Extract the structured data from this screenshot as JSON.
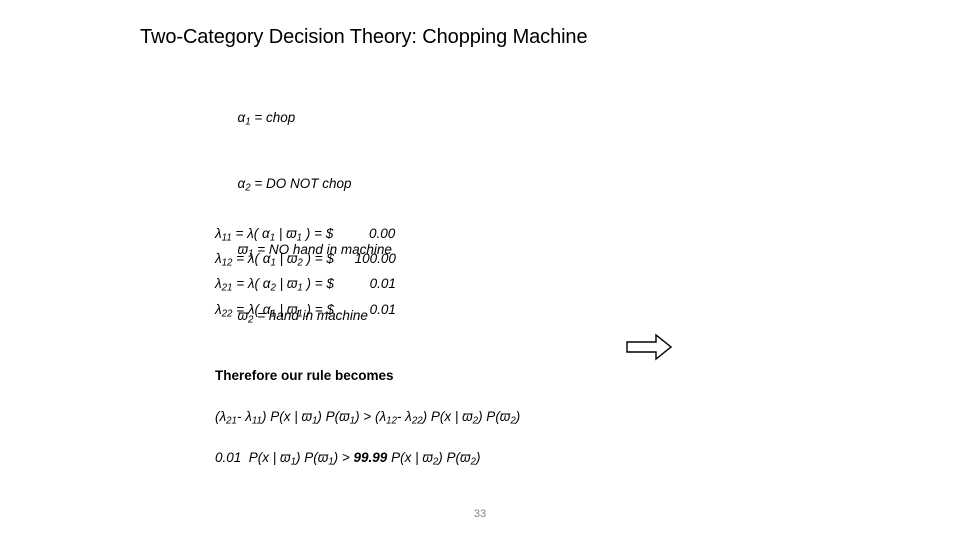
{
  "slide": {
    "title": "Two-Category Decision Theory: Chopping Machine",
    "page_number": "33",
    "page_number_color": "#808080",
    "background_color": "#ffffff",
    "text_color": "#000000"
  },
  "definitions": [
    {
      "symbol": "α",
      "subscript": "1",
      "equals": " = ",
      "meaning": "chop"
    },
    {
      "symbol": "α",
      "subscript": "2",
      "equals": " = ",
      "meaning": "DO NOT chop"
    },
    {
      "symbol": "ϖ",
      "subscript": "1",
      "equals": " = ",
      "meaning": "NO hand in machine"
    },
    {
      "symbol": "ϖ",
      "subscript": "2",
      "equals": " = ",
      "meaning": "hand in machine"
    }
  ],
  "losses": [
    {
      "label_symbol": "λ",
      "label_subscript": "11",
      "expression": " = λ( α",
      "action_subscript": "1",
      "bar": " | ϖ",
      "state_subscript": "1",
      "tail": " ) = $",
      "amount": "0.00"
    },
    {
      "label_symbol": "λ",
      "label_subscript": "12",
      "expression": " = λ( α",
      "action_subscript": "1",
      "bar": " | ϖ",
      "state_subscript": "2",
      "tail": " ) = $",
      "amount": "100.00"
    },
    {
      "label_symbol": "λ",
      "label_subscript": "21",
      "expression": " = λ( α",
      "action_subscript": "2",
      "bar": " | ϖ",
      "state_subscript": "1",
      "tail": " ) = $",
      "amount": "0.01"
    },
    {
      "label_symbol": "λ",
      "label_subscript": "22",
      "expression": " = λ( α",
      "action_subscript": "1",
      "bar": " | ϖ",
      "state_subscript": "1",
      "tail": " ) = $",
      "amount": "0.01"
    }
  ],
  "arrow": {
    "icon": "right-block-arrow-icon",
    "direction": "right",
    "fill": "#ffffff",
    "stroke": "#000000"
  },
  "conclusion": {
    "heading": "Therefore our rule becomes",
    "formula": {
      "p1": "(λ",
      "s1": "21",
      "p2": "- λ",
      "s2": "11",
      "p3": ") P(x | ϖ",
      "s3": "1",
      "p4": ") P(ϖ",
      "s4": "1",
      "p5": ") > (λ",
      "s5": "12",
      "p6": "- λ",
      "s6": "22",
      "p7": ") P(x | ϖ",
      "s7": "2",
      "p8": ") P(ϖ",
      "s8": "2",
      "p9": ")"
    },
    "numeric": {
      "left_value": "0.01",
      "left_mid": "  P(x | ϖ",
      "ls1": "1",
      "left_mid2": ") P(ϖ",
      "ls2": "1",
      "left_tail": ") > ",
      "right_value": "99.99",
      "right_mid": " P(x | ϖ",
      "rs1": "2",
      "right_mid2": ") P(ϖ",
      "rs2": "2",
      "right_tail": ")"
    }
  }
}
